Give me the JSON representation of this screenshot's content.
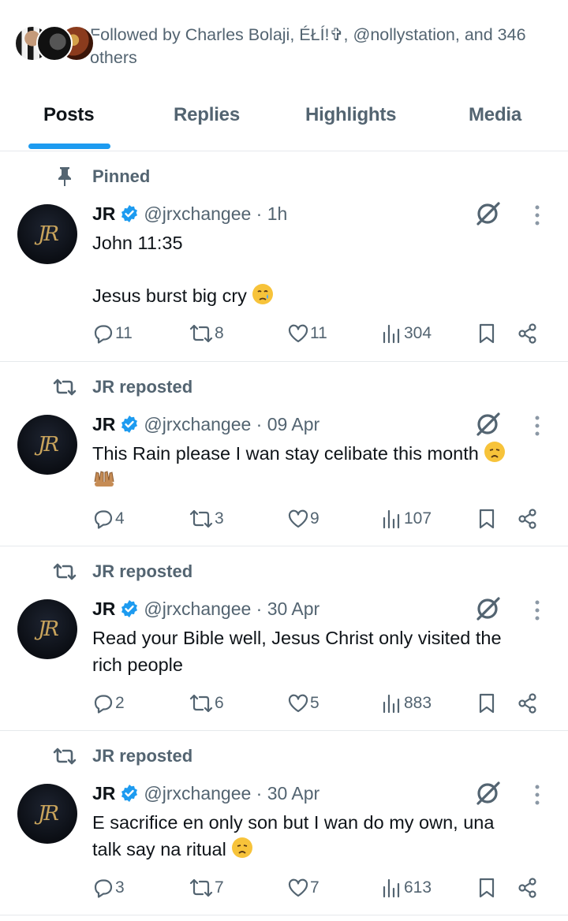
{
  "followed": {
    "text": "Followed by Charles Bolaji, ÉŁÍ!✞, @nollystation, and 346 others"
  },
  "tabs": [
    {
      "label": "Posts",
      "active": true
    },
    {
      "label": "Replies",
      "active": false
    },
    {
      "label": "Highlights",
      "active": false
    },
    {
      "label": "Media",
      "active": false
    }
  ],
  "posts": [
    {
      "context": "Pinned",
      "context_icon": "pin-icon",
      "avatar_text": "JR",
      "name": "JR",
      "handle_time": "@jrxchangee · 1h",
      "text_lines": [
        "John 11:35",
        "",
        "Jesus burst big cry"
      ],
      "text_emoji": "crying-face-emoji",
      "replies": "11",
      "reposts": "8",
      "likes": "11",
      "views": "304"
    },
    {
      "context": "JR reposted",
      "context_icon": "repost-icon",
      "avatar_text": "JR",
      "name": "JR",
      "handle_time": "@jrxchangee · 09 Apr",
      "text_lines": [
        "This Rain please I wan stay celibate this month"
      ],
      "text_emoji": "tired-face-emoji, palms-up-emoji",
      "replies": "4",
      "reposts": "3",
      "likes": "9",
      "views": "107"
    },
    {
      "context": "JR reposted",
      "context_icon": "repost-icon",
      "avatar_text": "JR",
      "name": "JR",
      "handle_time": "@jrxchangee · 30 Apr",
      "text_lines": [
        "Read your Bible well, Jesus Christ only visited the",
        "rich people"
      ],
      "replies": "2",
      "reposts": "6",
      "likes": "5",
      "views": "883"
    },
    {
      "context": "JR reposted",
      "context_icon": "repost-icon",
      "avatar_text": "JR",
      "name": "JR",
      "handle_time": "@jrxchangee · 30 Apr",
      "text_lines": [
        "E sacrifice en only son but I wan do my own, una",
        "talk say na ritual"
      ],
      "text_emoji": "tired-face-emoji",
      "replies": "3",
      "reposts": "7",
      "likes": "7",
      "views": "613"
    }
  ],
  "colors": {
    "accent": "#1d9bf0",
    "secondary_text": "#536471",
    "primary_text": "#0f1419",
    "avatar_gold": "#c9a45c"
  }
}
